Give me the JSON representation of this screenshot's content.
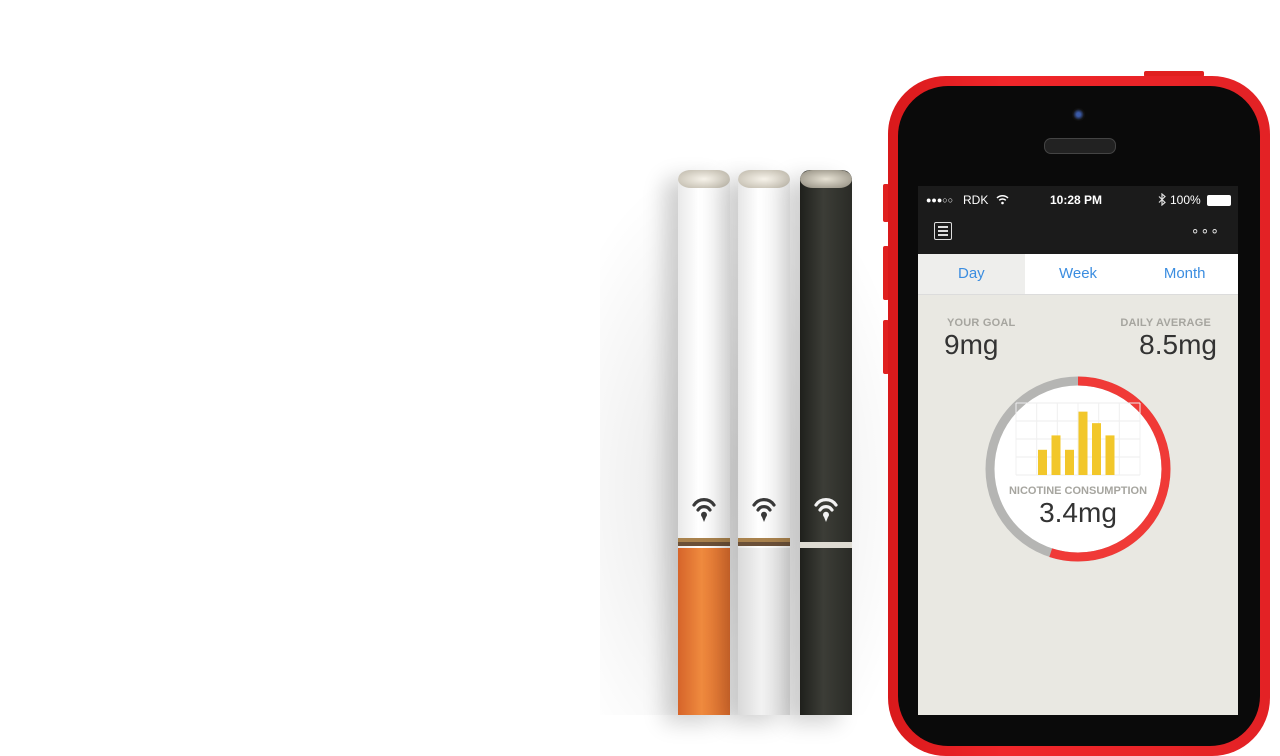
{
  "status_bar": {
    "carrier": "RDK",
    "signal_dots": "●●●○○",
    "time": "10:28 PM",
    "battery": "100%"
  },
  "app_bar": {
    "menu_icon": "settings-list-icon",
    "more_icon": "more-dots-icon",
    "more_glyph": "∘∘∘"
  },
  "tabs": [
    {
      "label": "Day",
      "active": true
    },
    {
      "label": "Week",
      "active": false
    },
    {
      "label": "Month",
      "active": false
    }
  ],
  "stats": {
    "goal_label": "YOUR GOAL",
    "goal_value": "9mg",
    "average_label": "DAILY AVERAGE",
    "average_value": "8.5mg"
  },
  "consumption": {
    "label": "NICOTINE CONSUMPTION",
    "value": "3.4mg",
    "ring_progress_fraction": 0.55,
    "ring_color": "#f03a37",
    "ring_track_color": "#b5b5b3",
    "bar_color": "#f2c72a",
    "bars": [
      0.35,
      0.55,
      0.35,
      0.88,
      0.72,
      0.55
    ]
  },
  "colors": {
    "phone_body": "#e32225",
    "tab_text": "#3b8de0",
    "content_bg": "#e9e8e2"
  }
}
